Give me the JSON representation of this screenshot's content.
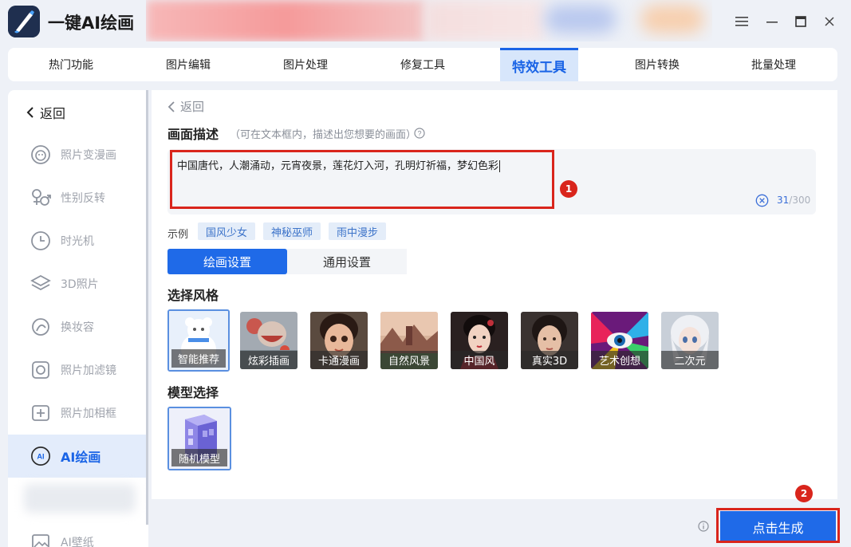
{
  "app": {
    "title": "一键AI绘画"
  },
  "top_nav": {
    "tabs": [
      {
        "label": "热门功能"
      },
      {
        "label": "图片编辑"
      },
      {
        "label": "图片处理"
      },
      {
        "label": "修复工具"
      },
      {
        "label": "特效工具",
        "active": true
      },
      {
        "label": "图片转换"
      },
      {
        "label": "批量处理"
      }
    ]
  },
  "sidebar": {
    "back_label": "返回",
    "items": [
      {
        "label": "照片变漫画",
        "icon": "cartoon-face-icon"
      },
      {
        "label": "性别反转",
        "icon": "gender-icon"
      },
      {
        "label": "时光机",
        "icon": "clock-icon"
      },
      {
        "label": "3D照片",
        "icon": "layers-icon"
      },
      {
        "label": "换妆容",
        "icon": "makeup-icon"
      },
      {
        "label": "照片加滤镜",
        "icon": "filter-icon"
      },
      {
        "label": "照片加相框",
        "icon": "frame-icon"
      },
      {
        "label": "AI绘画",
        "icon": "ai-icon",
        "active": true
      },
      {
        "label": "AI壁纸",
        "icon": "wallpaper-icon"
      }
    ]
  },
  "main": {
    "back_label": "返回",
    "description": {
      "title": "画面描述",
      "hint": "（可在文本框内，描述出您想要的画面）",
      "value": "中国唐代，人潮涌动，元宵夜景，莲花灯入河，孔明灯祈福，梦幻色彩",
      "count_current": "31",
      "count_max": "/300"
    },
    "examples": {
      "label": "示例",
      "chips": [
        "国风少女",
        "神秘巫师",
        "雨中漫步"
      ]
    },
    "settings_tabs": [
      {
        "label": "绘画设置",
        "active": true
      },
      {
        "label": "通用设置"
      }
    ],
    "style_section": {
      "title": "选择风格",
      "styles": [
        {
          "label": "智能推荐",
          "selected": true
        },
        {
          "label": "炫彩插画"
        },
        {
          "label": "卡通漫画"
        },
        {
          "label": "自然风景"
        },
        {
          "label": "中国风"
        },
        {
          "label": "真实3D"
        },
        {
          "label": "艺术创想"
        },
        {
          "label": "二次元"
        }
      ]
    },
    "model_section": {
      "title": "模型选择",
      "models": [
        {
          "label": "随机模型",
          "selected": true
        }
      ]
    }
  },
  "annotations": {
    "badge1": "1",
    "badge2": "2"
  },
  "footer": {
    "generate_label": "点击生成"
  },
  "colors": {
    "accent": "#1f6ae8",
    "highlight_red": "#d9251c"
  }
}
